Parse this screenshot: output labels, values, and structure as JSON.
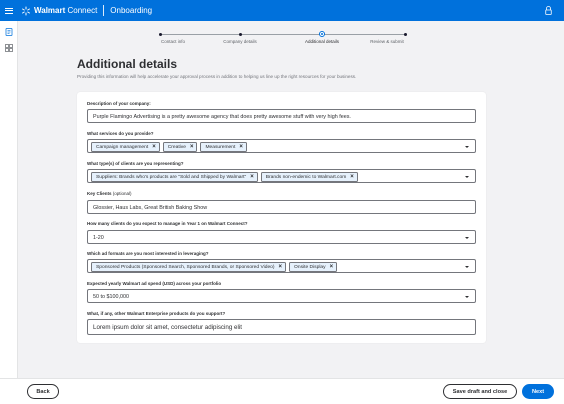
{
  "header": {
    "brand_bold": "Walmart",
    "brand_light": "Connect",
    "section": "Onboarding"
  },
  "stepper": {
    "steps": [
      {
        "label": "Contact info",
        "state": "done"
      },
      {
        "label": "Company details",
        "state": "done"
      },
      {
        "label": "Additional details",
        "state": "current"
      },
      {
        "label": "Review & submit",
        "state": "pending"
      }
    ]
  },
  "page": {
    "title": "Additional details",
    "subtitle": "Providing this information will help accelerate your approval process in addition to helping us line up the right resources for your business."
  },
  "form": {
    "company_description": {
      "label": "Description of your company:",
      "value": "Purple Flamingo Advertising is a pretty awesome agency that does pretty awesome stuff with very high fees."
    },
    "services": {
      "label": "What services do you provide?",
      "chips": [
        "Campaign management",
        "Creative",
        "Measurement"
      ]
    },
    "client_types": {
      "label": "What type(s) of clients are you representing?",
      "chips": [
        "Suppliers: Brands who's products are \"Sold and Shipped by Walmart\"",
        "Brands non-endemic to Walmart.com"
      ]
    },
    "key_clients": {
      "label": "Key Clients",
      "optional": "(optional)",
      "value": "Glossier, Haus Labs, Great British Baking Show"
    },
    "client_count": {
      "label": "How many clients do you expect to manage in Year 1 on Walmart Connect?",
      "value": "1-20"
    },
    "ad_formats": {
      "label": "Which ad formats are you most interested in leveraging?",
      "chips": [
        "Sponsored Products (Sponsored Search, Sponsored Brands, or Sponsored Video)",
        "Onsite Display"
      ]
    },
    "ad_spend": {
      "label": "Expected yearly Walmart ad spend (USD) across your portfolio",
      "value": "50 to $100,000"
    },
    "other_products": {
      "label": "What, if any, other Walmart Enterprise products do you support?",
      "value": "Lorem ipsum dolor sit amet, consectetur adipiscing elit"
    }
  },
  "footer": {
    "back_label": "Back",
    "save_label": "Save draft and close",
    "next_label": "Next"
  },
  "colors": {
    "brand_blue": "#0071dc",
    "chip_bg": "#e6f1fc",
    "spark_yellow": "#ffc220"
  },
  "icons": [
    "menu-icon",
    "spark-logo-icon",
    "lock-icon",
    "document-icon",
    "grid-icon",
    "remove-chip-icon",
    "chevron-down-icon"
  ]
}
